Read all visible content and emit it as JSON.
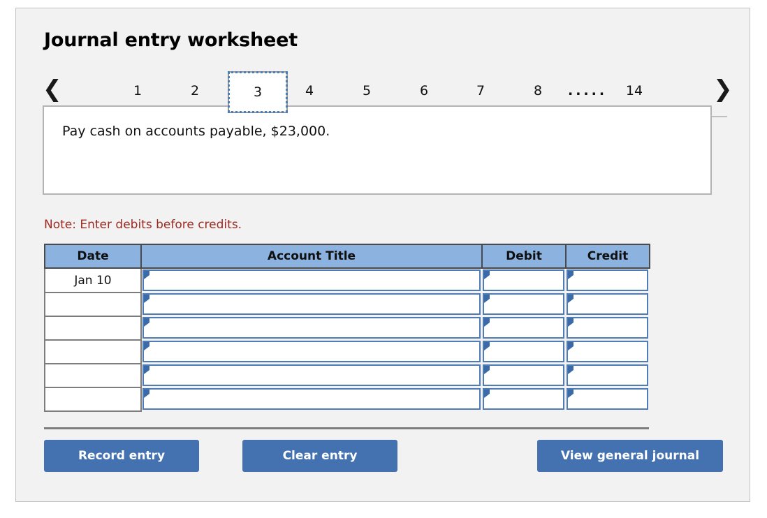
{
  "page": {
    "title": "Journal entry worksheet"
  },
  "pager": {
    "prev_icon": "chevron-left-icon",
    "next_icon": "chevron-right-icon",
    "ellipsis": ".....",
    "active_tab": "3",
    "tabs": [
      {
        "label": "1",
        "active": false
      },
      {
        "label": "2",
        "active": false
      },
      {
        "label": "3",
        "active": true
      },
      {
        "label": "4",
        "active": false
      },
      {
        "label": "5",
        "active": false
      },
      {
        "label": "6",
        "active": false
      },
      {
        "label": "7",
        "active": false
      },
      {
        "label": "8",
        "active": false
      },
      {
        "label": "14",
        "active": false
      }
    ]
  },
  "description": {
    "text": "Pay cash on accounts payable, $23,000."
  },
  "note": {
    "text": "Note: Enter debits before credits."
  },
  "journal": {
    "columns": [
      "Date",
      "Account Title",
      "Debit",
      "Credit"
    ],
    "rows": [
      {
        "date": "Jan 10",
        "account_title": "",
        "debit": "",
        "credit": ""
      },
      {
        "date": "",
        "account_title": "",
        "debit": "",
        "credit": ""
      },
      {
        "date": "",
        "account_title": "",
        "debit": "",
        "credit": ""
      },
      {
        "date": "",
        "account_title": "",
        "debit": "",
        "credit": ""
      },
      {
        "date": "",
        "account_title": "",
        "debit": "",
        "credit": ""
      },
      {
        "date": "",
        "account_title": "",
        "debit": "",
        "credit": ""
      }
    ]
  },
  "actions": {
    "record_label": "Record entry",
    "clear_label": "Clear entry",
    "view_label": "View general journal"
  },
  "colors": {
    "panel_background": "#f2f2f2",
    "header_blue": "#8cb2e0",
    "button_blue": "#4472b0",
    "note_red": "#9e2b22",
    "input_border_blue": "#4f7cb5"
  }
}
